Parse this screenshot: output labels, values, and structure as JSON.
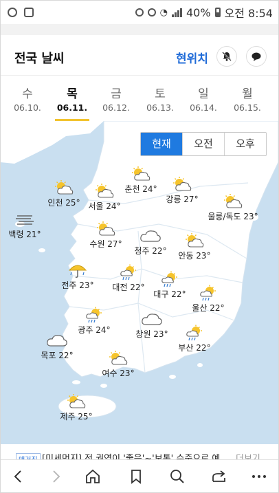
{
  "status": {
    "battery": "40%",
    "time": "오전 8:54"
  },
  "header": {
    "title": "전국 날씨",
    "location_button": "현위치",
    "bell_icon": "bell-off-icon",
    "chat_icon": "chat-icon"
  },
  "days": [
    {
      "name": "수",
      "date": "06.10."
    },
    {
      "name": "목",
      "date": "06.11."
    },
    {
      "name": "금",
      "date": "06.12."
    },
    {
      "name": "토",
      "date": "06.13."
    },
    {
      "name": "일",
      "date": "06.14."
    },
    {
      "name": "월",
      "date": "06.15."
    }
  ],
  "selected_day": 1,
  "time_toggle": [
    "현재",
    "오전",
    "오후"
  ],
  "active_time": 0,
  "cities": [
    {
      "label": "인천 25°",
      "icon": "partly-cloudy"
    },
    {
      "label": "서울 24°",
      "icon": "partly-cloudy"
    },
    {
      "label": "춘천 24°",
      "icon": "partly-cloudy"
    },
    {
      "label": "강릉 27°",
      "icon": "partly-cloudy"
    },
    {
      "label": "울릉/독도 23°",
      "icon": "partly-cloudy"
    },
    {
      "label": "백령 21°",
      "icon": "haze"
    },
    {
      "label": "수원 27°",
      "icon": "partly-cloudy"
    },
    {
      "label": "청주 22°",
      "icon": "cloudy"
    },
    {
      "label": "안동 23°",
      "icon": "partly-cloudy"
    },
    {
      "label": "전주 23°",
      "icon": "umbrella-rain"
    },
    {
      "label": "대전 22°",
      "icon": "sun-rain"
    },
    {
      "label": "대구 22°",
      "icon": "sun-rain"
    },
    {
      "label": "울산 22°",
      "icon": "sun-rain"
    },
    {
      "label": "광주 24°",
      "icon": "sun-rain"
    },
    {
      "label": "창원 23°",
      "icon": "cloudy"
    },
    {
      "label": "부산 22°",
      "icon": "sun-rain"
    },
    {
      "label": "목포 22°",
      "icon": "cloudy"
    },
    {
      "label": "여수 23°",
      "icon": "partly-cloudy"
    },
    {
      "label": "제주 25°",
      "icon": "partly-cloudy"
    }
  ],
  "news": {
    "tag": "매거진",
    "text": "[미세먼지] 전 권역이 '좋음'~'보통' 수준으로 예",
    "more": "더보기"
  },
  "nav_icons": [
    "back-icon",
    "forward-icon",
    "home-icon",
    "bookmark-icon",
    "search-icon",
    "share-icon",
    "more-icon"
  ]
}
